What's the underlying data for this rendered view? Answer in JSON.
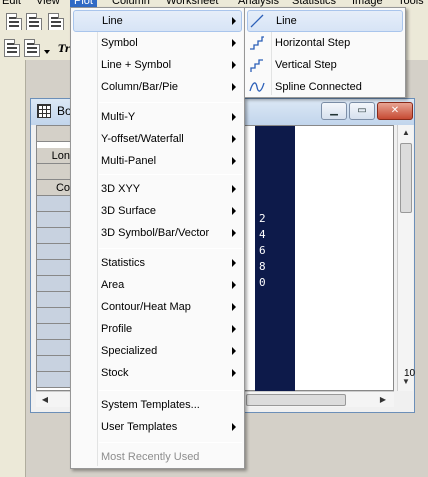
{
  "menubar": {
    "items": [
      {
        "label": "Edit"
      },
      {
        "label": "View"
      },
      {
        "label": "Plot",
        "active": true
      },
      {
        "label": "Column"
      },
      {
        "label": "Worksheet"
      },
      {
        "label": "Analysis"
      },
      {
        "label": "Statistics"
      },
      {
        "label": "Image"
      },
      {
        "label": "Tools"
      }
    ]
  },
  "toolbar": {
    "icons": [
      "worksheet-icon",
      "worksheet-icon",
      "worksheet-icon",
      "worksheet-icon",
      "worksheet-icon"
    ],
    "font_glyph": "Tr"
  },
  "child_window": {
    "title": "Bo",
    "icon": "worksheet-icon",
    "row_headers": [
      "",
      "Lon",
      "",
      "Co",
      "",
      "",
      "",
      "",
      "",
      "",
      "",
      "",
      "",
      "",
      "",
      ""
    ],
    "dark_column_values": [
      "2",
      "4",
      "6",
      "8",
      "0"
    ],
    "side_value": "10"
  },
  "plot_menu": {
    "groups": [
      {
        "items": [
          {
            "label": "Line",
            "submenu": true,
            "highlighted": true
          },
          {
            "label": "Symbol",
            "submenu": true
          },
          {
            "label": "Line + Symbol",
            "submenu": true
          },
          {
            "label": "Column/Bar/Pie",
            "submenu": true
          }
        ]
      },
      {
        "items": [
          {
            "label": "Multi-Y",
            "submenu": true
          },
          {
            "label": "Y-offset/Waterfall",
            "submenu": true
          },
          {
            "label": "Multi-Panel",
            "submenu": true
          }
        ]
      },
      {
        "items": [
          {
            "label": "3D XYY",
            "submenu": true
          },
          {
            "label": "3D Surface",
            "submenu": true
          },
          {
            "label": "3D Symbol/Bar/Vector",
            "submenu": true
          }
        ]
      },
      {
        "items": [
          {
            "label": "Statistics",
            "submenu": true
          },
          {
            "label": "Area",
            "submenu": true
          },
          {
            "label": "Contour/Heat Map",
            "submenu": true
          },
          {
            "label": "Profile",
            "submenu": true
          },
          {
            "label": "Specialized",
            "submenu": true
          },
          {
            "label": "Stock",
            "submenu": true
          }
        ]
      },
      {
        "items": [
          {
            "label": "System Templates...",
            "submenu": false
          },
          {
            "label": "User Templates",
            "submenu": true
          }
        ]
      },
      {
        "items": [
          {
            "label": "Most Recently Used",
            "submenu": false,
            "disabled": true
          }
        ]
      }
    ]
  },
  "line_submenu": {
    "items": [
      {
        "label": "Line",
        "icon": "line-plot-icon",
        "highlighted": true
      },
      {
        "label": "Horizontal Step",
        "icon": "horizontal-step-icon"
      },
      {
        "label": "Vertical Step",
        "icon": "vertical-step-icon"
      },
      {
        "label": "Spline Connected",
        "icon": "spline-connected-icon"
      }
    ]
  },
  "colors": {
    "menu_highlight_border": "#a9c5ec",
    "menu_highlight_bg": "#dde8f8",
    "icon_blue": "#2b5fb8",
    "dark_column": "#0d1a4a"
  }
}
